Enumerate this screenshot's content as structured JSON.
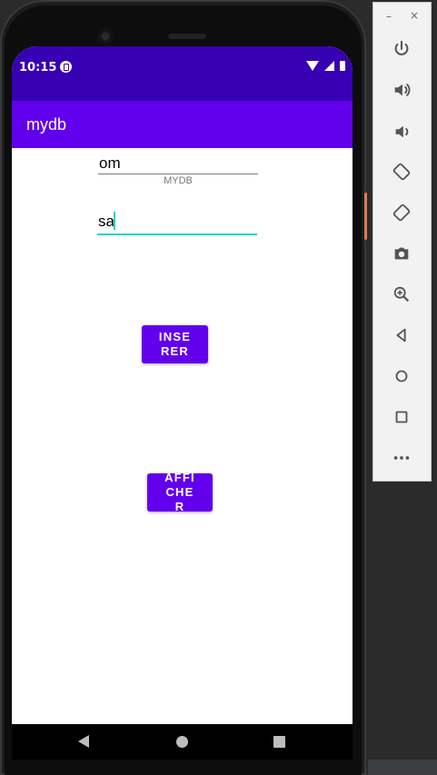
{
  "status_bar": {
    "time": "10:15"
  },
  "app_bar": {
    "title": "mydb"
  },
  "form": {
    "field1_value": "om",
    "field1_hint": "MYDB",
    "field2_value": "sa"
  },
  "buttons": {
    "insert_label": "INSERER",
    "show_label": "AFFICHER"
  },
  "emulator": {
    "minimize": "–",
    "close": "×",
    "tools": [
      "power-icon",
      "volume-up-icon",
      "volume-down-icon",
      "rotate-left-icon",
      "rotate-right-icon",
      "camera-icon",
      "zoom-icon",
      "back-icon",
      "home-icon",
      "overview-icon",
      "more-icon"
    ]
  },
  "colors": {
    "primary": "#6200ee",
    "primary_dark": "#3700b3",
    "accent": "#03dac5"
  }
}
